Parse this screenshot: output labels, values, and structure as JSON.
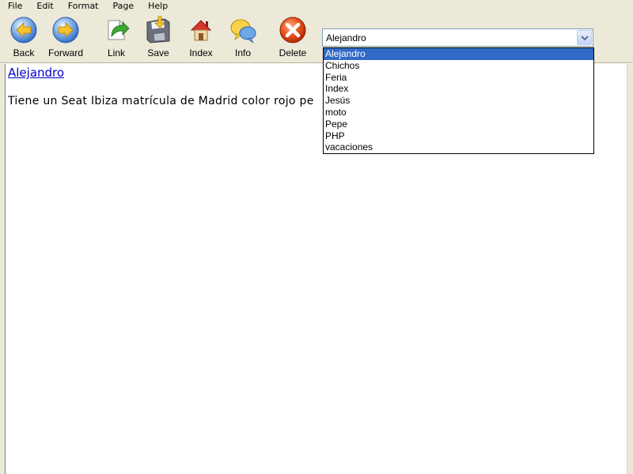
{
  "menu": {
    "items": [
      "File",
      "Edit",
      "Format",
      "Page",
      "Help"
    ]
  },
  "toolbar": {
    "back_label": "Back",
    "forward_label": "Forward",
    "link_label": "Link",
    "save_label": "Save",
    "index_label": "Index",
    "info_label": "Info",
    "delete_label": "Delete"
  },
  "page_select": {
    "selected": "Alejandro",
    "options": [
      "Alejandro",
      "Chichos",
      "Feria",
      "Index",
      "Jesús",
      "moto",
      "Pepe",
      "PHP",
      "vacaciones"
    ],
    "highlighted_index": 0
  },
  "page": {
    "link_text": "Alejandro",
    "body_text": "Tiene un Seat Ibiza matrícula de Madrid color rojo pe"
  },
  "colors": {
    "chrome": "#ece9d8",
    "selection": "#3169c6",
    "link": "#0000cc"
  }
}
